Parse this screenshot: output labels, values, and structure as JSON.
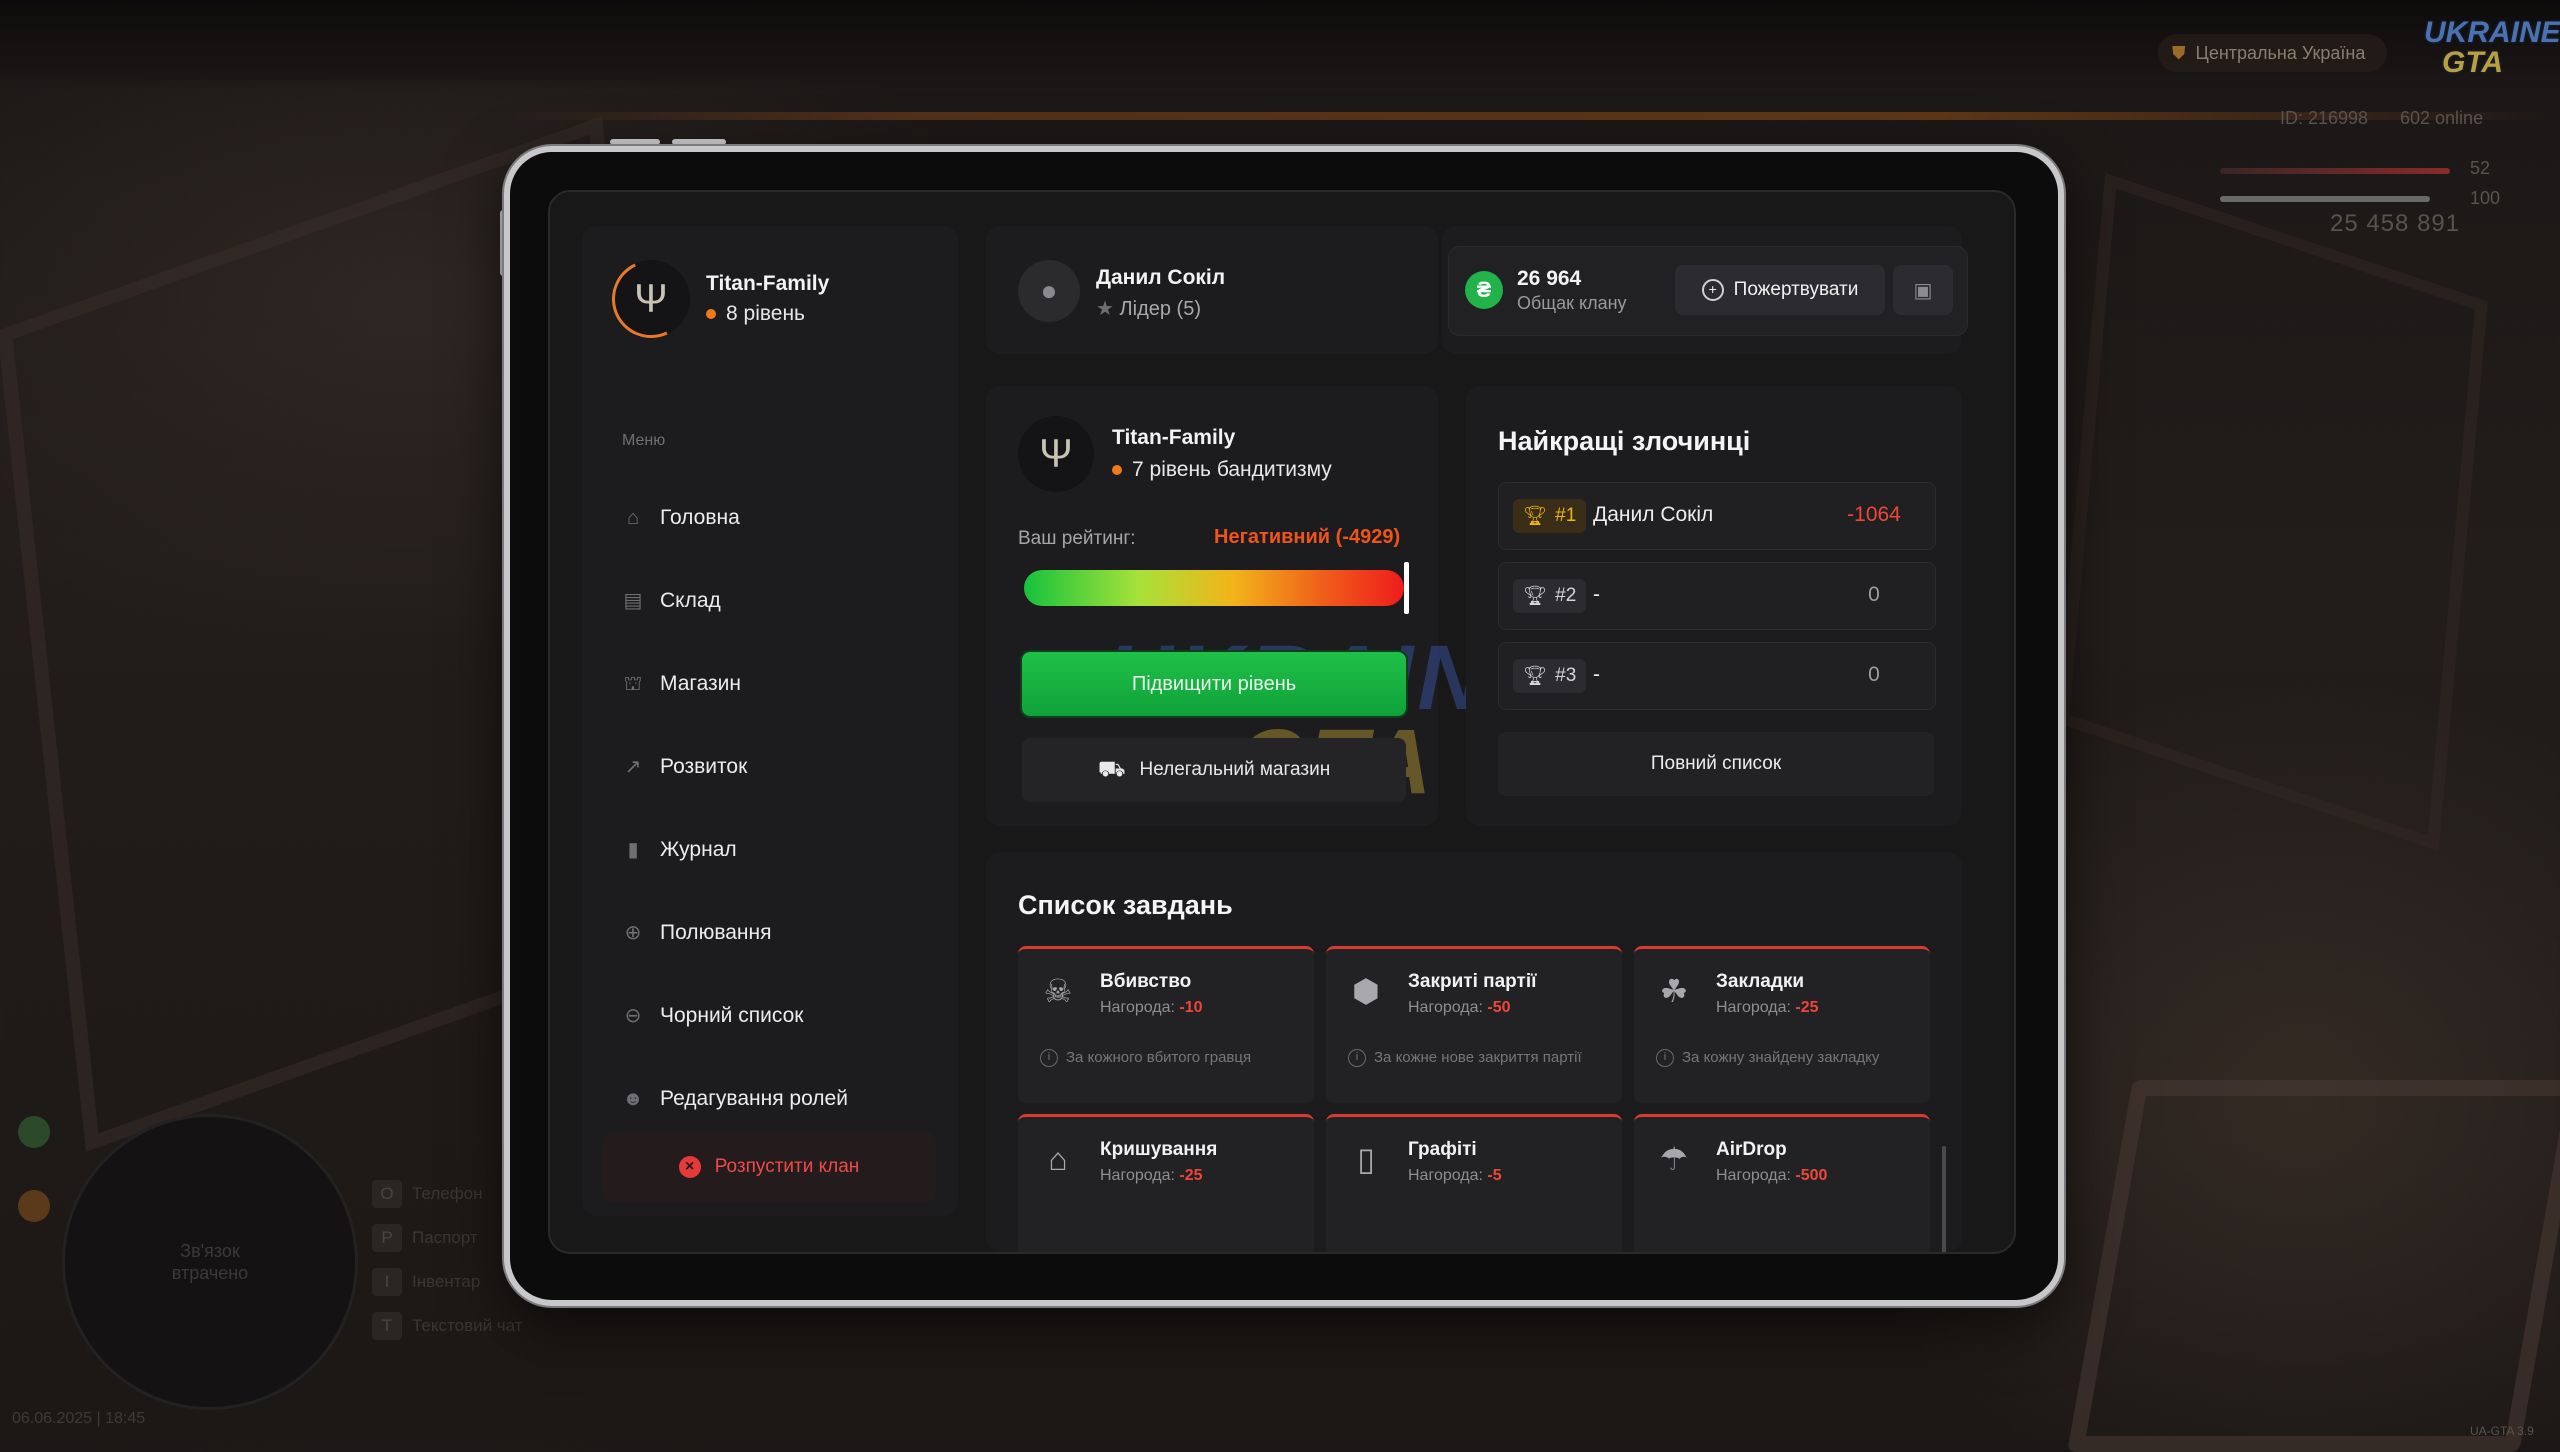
{
  "hud": {
    "region": "Центральна Україна",
    "logo_top": "UKRAINE",
    "logo_bottom": "GTA",
    "player_id": "ID: 216998",
    "online": "602 online",
    "health": "52",
    "armor": "100",
    "money": "25 458 891",
    "minimap_status": "Зв'язок втрачено",
    "keys": [
      {
        "key": "O",
        "label": "Телефон"
      },
      {
        "key": "P",
        "label": "Паспорт"
      },
      {
        "key": "I",
        "label": "Інвентар"
      },
      {
        "key": "T",
        "label": "Текстовий чат"
      }
    ],
    "date": "06.06.2025 | 18:45",
    "version": "UA-GTA 3.9"
  },
  "sidebar": {
    "clan_name": "Titan-Family",
    "clan_level": "8 рівень",
    "menu_label": "Меню",
    "items": [
      {
        "label": "Головна",
        "icon": "home-icon"
      },
      {
        "label": "Склад",
        "icon": "warehouse-icon"
      },
      {
        "label": "Магазин",
        "icon": "shop-icon"
      },
      {
        "label": "Розвиток",
        "icon": "chart-icon"
      },
      {
        "label": "Журнал",
        "icon": "journal-icon"
      },
      {
        "label": "Полювання",
        "icon": "crosshair-icon"
      },
      {
        "label": "Чорний список",
        "icon": "block-icon"
      },
      {
        "label": "Редагування ролей",
        "icon": "roles-icon"
      }
    ],
    "disband_label": "Розпустити клан"
  },
  "user": {
    "name": "Данил Сокіл",
    "role": "Лідер (5)"
  },
  "bank": {
    "amount": "26 964",
    "label": "Общак клану",
    "donate_label": "Пожертвувати"
  },
  "rating": {
    "clan_name": "Titan-Family",
    "banditry_level": "7 рівень бандитизму",
    "label": "Ваш рейтинг:",
    "value": "Негативний (-4929)",
    "level_up_label": "Підвищити рівень",
    "illegal_shop_label": "Нелегальний магазин"
  },
  "criminals": {
    "title": "Найкращі злочинці",
    "rows": [
      {
        "rank": "#1",
        "name": "Данил Сокіл",
        "score": "-1064"
      },
      {
        "rank": "#2",
        "name": "-",
        "score": "0"
      },
      {
        "rank": "#3",
        "name": "-",
        "score": "0"
      }
    ],
    "full_list_label": "Повний список"
  },
  "tasks": {
    "title": "Список завдань",
    "reward_label": "Нагорода:",
    "items": [
      {
        "name": "Вбивство",
        "reward": "-10",
        "desc": "За кожного вбитого гравця",
        "icon": "skull-icon"
      },
      {
        "name": "Закриті партії",
        "reward": "-50",
        "desc": "За кожне нове закриття партії",
        "icon": "box-icon"
      },
      {
        "name": "Закладки",
        "reward": "-25",
        "desc": "За кожну знайдену закладку",
        "icon": "stash-icon"
      },
      {
        "name": "Кришування",
        "reward": "-25",
        "desc": "",
        "icon": "shop-roof-icon"
      },
      {
        "name": "Графіті",
        "reward": "-5",
        "desc": "",
        "icon": "spray-can-icon"
      },
      {
        "name": "AirDrop",
        "reward": "-500",
        "desc": "",
        "icon": "parachute-icon"
      }
    ]
  },
  "colors": {
    "accent_orange": "#f07a1a",
    "negative_red": "#f0463a",
    "green": "#1fc048",
    "gold": "#f0b21a"
  }
}
